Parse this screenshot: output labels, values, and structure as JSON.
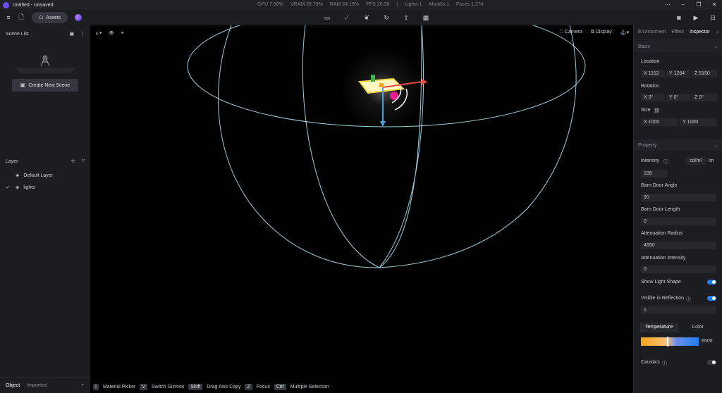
{
  "titlebar": {
    "title": "Untitled - Unsaved",
    "stats": {
      "gpu": "GPU 7.96%",
      "vram": "VRAM 39.79%",
      "ram": "RAM 24.19%",
      "fps": "FPS 20.38",
      "sep": "|",
      "lights": "Lights 1",
      "models": "Models 1",
      "faces": "Faces 1,274"
    }
  },
  "toolbar": {
    "assets_label": "Assets"
  },
  "left_panel": {
    "scene_list_label": "Scene List",
    "create_scene_label": "Create New Scene",
    "layer_label": "Layer",
    "layers": [
      {
        "name": "Default Layer"
      },
      {
        "name": "lights"
      }
    ],
    "tabs": {
      "object": "Object",
      "imported": "Imported"
    }
  },
  "viewport": {
    "camera_label": "Camera",
    "display_label": "Display",
    "hints": [
      {
        "key": "I",
        "label": "Material Picker"
      },
      {
        "key": "V",
        "label": "Switch Gizmos"
      },
      {
        "key": "Shift",
        "label": "Drag Axis Copy"
      },
      {
        "key": "Z",
        "label": "Focus"
      },
      {
        "key": "Ctrl",
        "label": "Multiple Selection"
      }
    ]
  },
  "right_panel": {
    "tabs": {
      "environment": "Environment",
      "effect": "Effect",
      "inspector": "Inspector"
    },
    "basic_label": "Basic",
    "location_label": "Location",
    "location": {
      "x_label": "X",
      "x": "1152",
      "y_label": "Y",
      "y": "1264",
      "z_label": "Z",
      "z": "5150"
    },
    "rotation_label": "Rotation",
    "rotation": {
      "x_label": "X",
      "x": "0°",
      "y_label": "Y",
      "y": "0°",
      "z_label": "Z",
      "z": "0°"
    },
    "size_label": "Size",
    "size": {
      "x_label": "X",
      "x": "1000",
      "y_label": "Y",
      "y": "1000"
    },
    "property_label": "Property",
    "intensity_label": "Intensity",
    "intensity_unit_a": "cd/m²",
    "intensity_unit_b": "lm",
    "intensity_value": "108",
    "barn_door_angle_label": "Barn Door Angle",
    "barn_door_angle": "90",
    "barn_door_length_label": "Barn Door Length",
    "barn_door_length": "0",
    "attenuation_radius_label": "Attenuation Radius",
    "attenuation_radius": "4650",
    "attenuation_intensity_label": "Attenuation Intensity",
    "attenuation_intensity": "0",
    "show_light_shape_label": "Show Light Shape",
    "show_light_shape": true,
    "visible_in_reflection_label": "Visible in Reflection",
    "visible_in_reflection": true,
    "reflection_value": "1",
    "temperature_tab": "Temperature",
    "color_tab": "Color",
    "temperature_value": "6500",
    "caustics_label": "Caustics",
    "caustics": false
  }
}
